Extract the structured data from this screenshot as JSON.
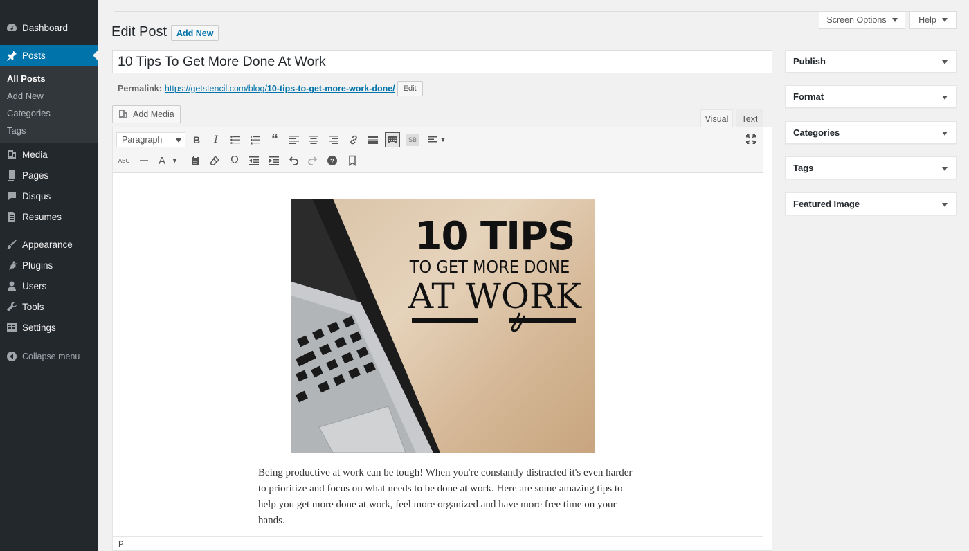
{
  "sidebar": {
    "items": [
      {
        "label": "Dashboard",
        "icon": "dashboard-icon"
      },
      {
        "label": "Posts",
        "icon": "pin-icon"
      },
      {
        "label": "Media",
        "icon": "media-icon"
      },
      {
        "label": "Pages",
        "icon": "pages-icon"
      },
      {
        "label": "Disqus",
        "icon": "comment-icon"
      },
      {
        "label": "Resumes",
        "icon": "document-icon"
      },
      {
        "label": "Appearance",
        "icon": "brush-icon"
      },
      {
        "label": "Plugins",
        "icon": "plugin-icon"
      },
      {
        "label": "Users",
        "icon": "user-icon"
      },
      {
        "label": "Tools",
        "icon": "wrench-icon"
      },
      {
        "label": "Settings",
        "icon": "settings-icon"
      }
    ],
    "submenu": [
      "All Posts",
      "Add New",
      "Categories",
      "Tags"
    ],
    "collapse_label": "Collapse menu",
    "active_color": "#0073aa"
  },
  "header": {
    "screen_options": "Screen Options",
    "help": "Help",
    "title": "Edit Post",
    "add_new": "Add New"
  },
  "post": {
    "title": "10 Tips To Get More Done At Work",
    "permalink_label": "Permalink:",
    "permalink_base": "https://getstencil.com/blog/",
    "permalink_slug": "10-tips-to-get-more-work-done/",
    "permalink_edit": "Edit"
  },
  "editor": {
    "add_media": "Add Media",
    "tab_visual": "Visual",
    "tab_text": "Text",
    "format_value": "Paragraph",
    "sb_label": "SB",
    "image_text": {
      "line1": "10 TIPS",
      "line2": "TO GET MORE DONE",
      "line3": "AT WORK"
    },
    "body": "Being productive at work can be tough! When you're constantly distracted it's even harder to prioritize and focus on what needs to be done at work. Here are some amazing tips to help you get more done at work, feel more organized and have more free time on your hands.",
    "status_path": "P"
  },
  "metaboxes": [
    "Publish",
    "Format",
    "Categories",
    "Tags",
    "Featured Image"
  ]
}
